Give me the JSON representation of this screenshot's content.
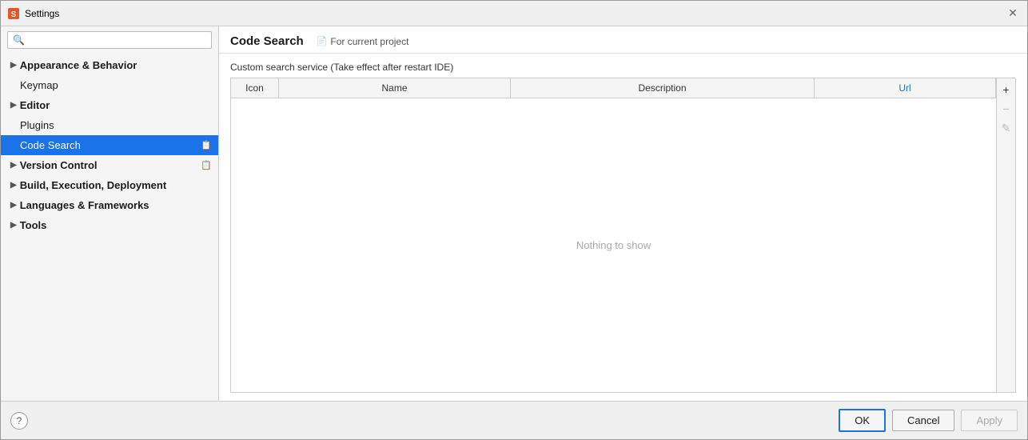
{
  "window": {
    "title": "Settings",
    "icon": "⚙"
  },
  "sidebar": {
    "search_placeholder": "Q",
    "items": [
      {
        "id": "appearance",
        "label": "Appearance & Behavior",
        "has_children": true,
        "active": false,
        "badge": ""
      },
      {
        "id": "keymap",
        "label": "Keymap",
        "has_children": false,
        "active": false,
        "badge": ""
      },
      {
        "id": "editor",
        "label": "Editor",
        "has_children": true,
        "active": false,
        "badge": ""
      },
      {
        "id": "plugins",
        "label": "Plugins",
        "has_children": false,
        "active": false,
        "badge": ""
      },
      {
        "id": "code-search",
        "label": "Code Search",
        "has_children": false,
        "active": true,
        "badge": "🗂"
      },
      {
        "id": "version-control",
        "label": "Version Control",
        "has_children": true,
        "active": false,
        "badge": "🗂"
      },
      {
        "id": "build",
        "label": "Build, Execution, Deployment",
        "has_children": true,
        "active": false,
        "badge": ""
      },
      {
        "id": "languages",
        "label": "Languages & Frameworks",
        "has_children": true,
        "active": false,
        "badge": ""
      },
      {
        "id": "tools",
        "label": "Tools",
        "has_children": true,
        "active": false,
        "badge": ""
      }
    ]
  },
  "panel": {
    "title": "Code Search",
    "tab_label": "For current project",
    "custom_search_label": "Custom search service (Take effect after restart IDE)",
    "table": {
      "columns": [
        "Icon",
        "Name",
        "Description",
        "Url"
      ],
      "empty_message": "Nothing to show"
    },
    "toolbar_buttons": [
      {
        "id": "add",
        "icon": "+",
        "label": "Add",
        "disabled": false
      },
      {
        "id": "remove",
        "icon": "−",
        "label": "Remove",
        "disabled": true
      },
      {
        "id": "edit",
        "icon": "✎",
        "label": "Edit",
        "disabled": true
      }
    ]
  },
  "footer": {
    "help_label": "?",
    "ok_label": "OK",
    "cancel_label": "Cancel",
    "apply_label": "Apply"
  }
}
